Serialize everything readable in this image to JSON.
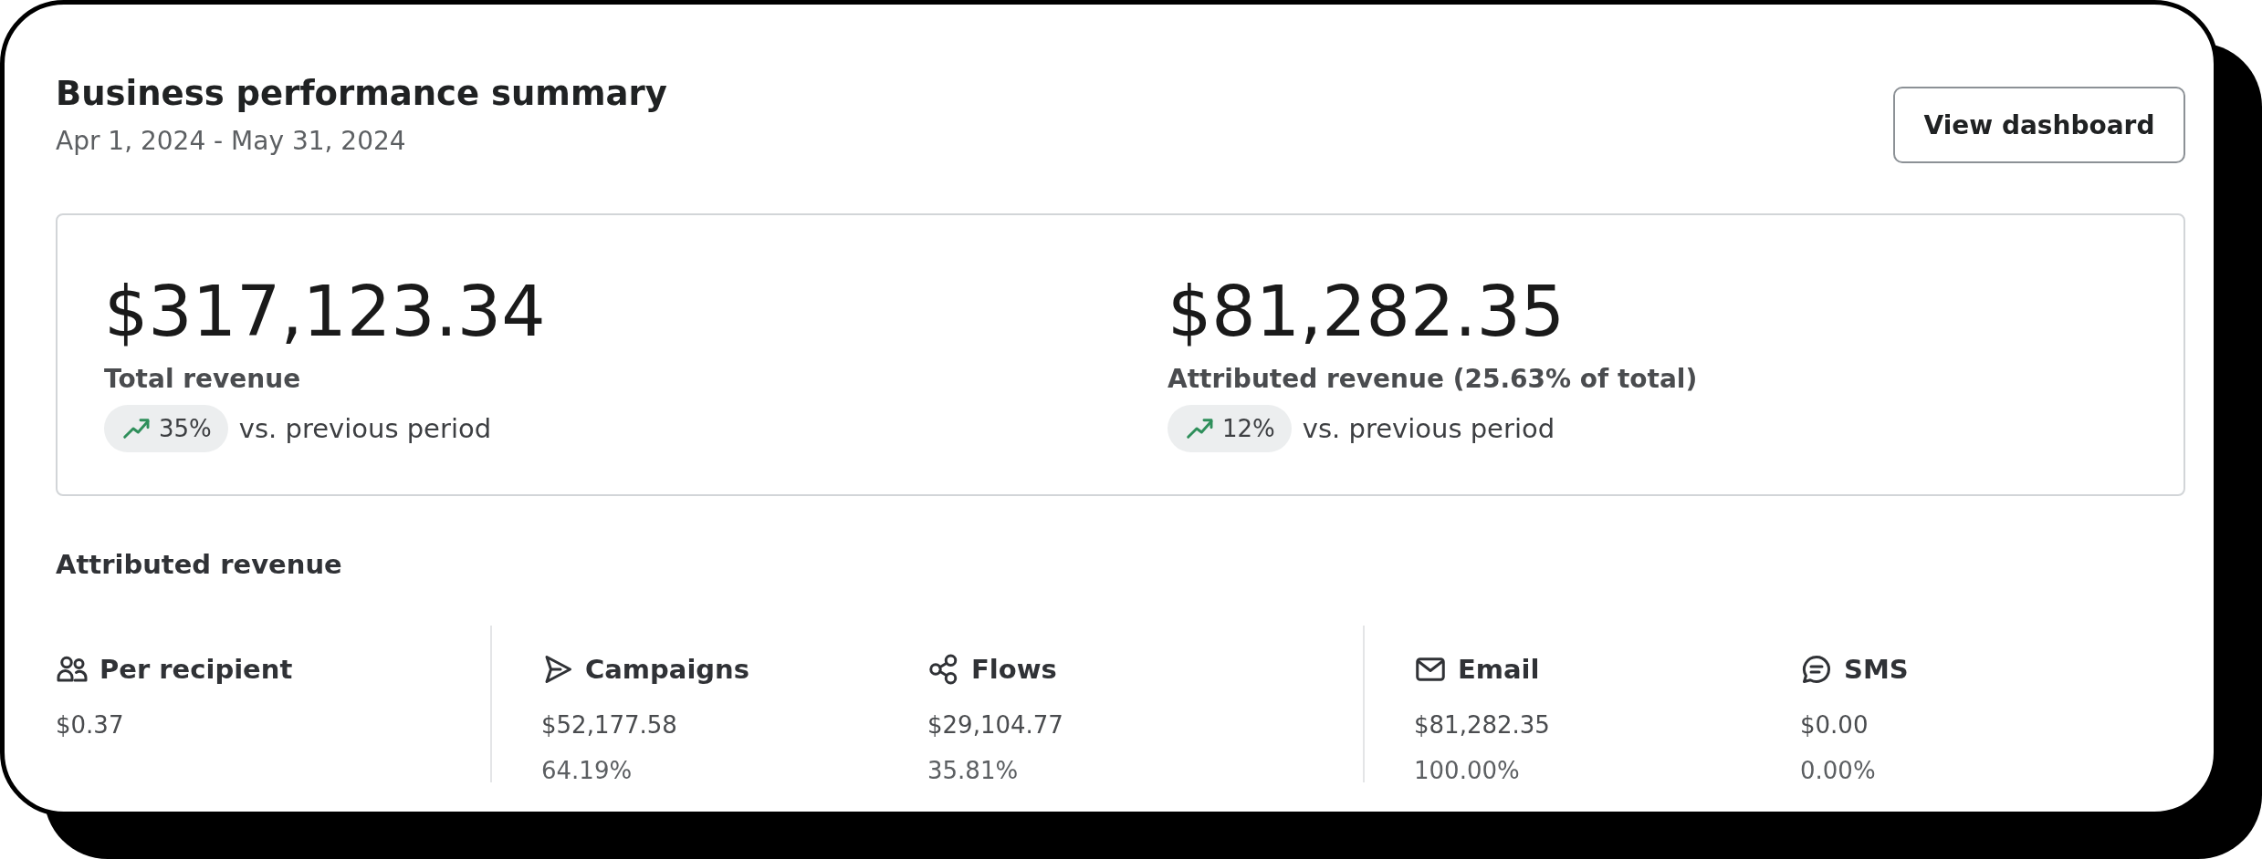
{
  "header": {
    "title": "Business performance summary",
    "date_range": "Apr 1, 2024 - May 31, 2024",
    "button": "View dashboard"
  },
  "stats": [
    {
      "value": "$317,123.34",
      "label": "Total revenue",
      "rising": true,
      "change": "35%",
      "comparison": "vs. previous period"
    },
    {
      "value": "$81,282.35",
      "label": "Attributed revenue (25.63% of total)",
      "rising": true,
      "change": "12%",
      "comparison": "vs. previous period"
    }
  ],
  "attributed": {
    "title": "Attributed revenue",
    "groups": [
      {
        "metrics": [
          {
            "kind": "people",
            "label": "Per recipient",
            "value": "$0.37"
          }
        ]
      },
      {
        "metrics": [
          {
            "kind": "send",
            "label": "Campaigns",
            "value": "$52,177.58",
            "share": "64.19%"
          },
          {
            "kind": "flows",
            "label": "Flows",
            "value": "$29,104.77",
            "share": "35.81%"
          }
        ]
      },
      {
        "metrics": [
          {
            "kind": "email",
            "label": "Email",
            "value": "$81,282.35",
            "share": "100.00%"
          },
          {
            "kind": "sms",
            "label": "SMS",
            "value": "$0.00",
            "share": "0.00%"
          }
        ]
      }
    ]
  }
}
